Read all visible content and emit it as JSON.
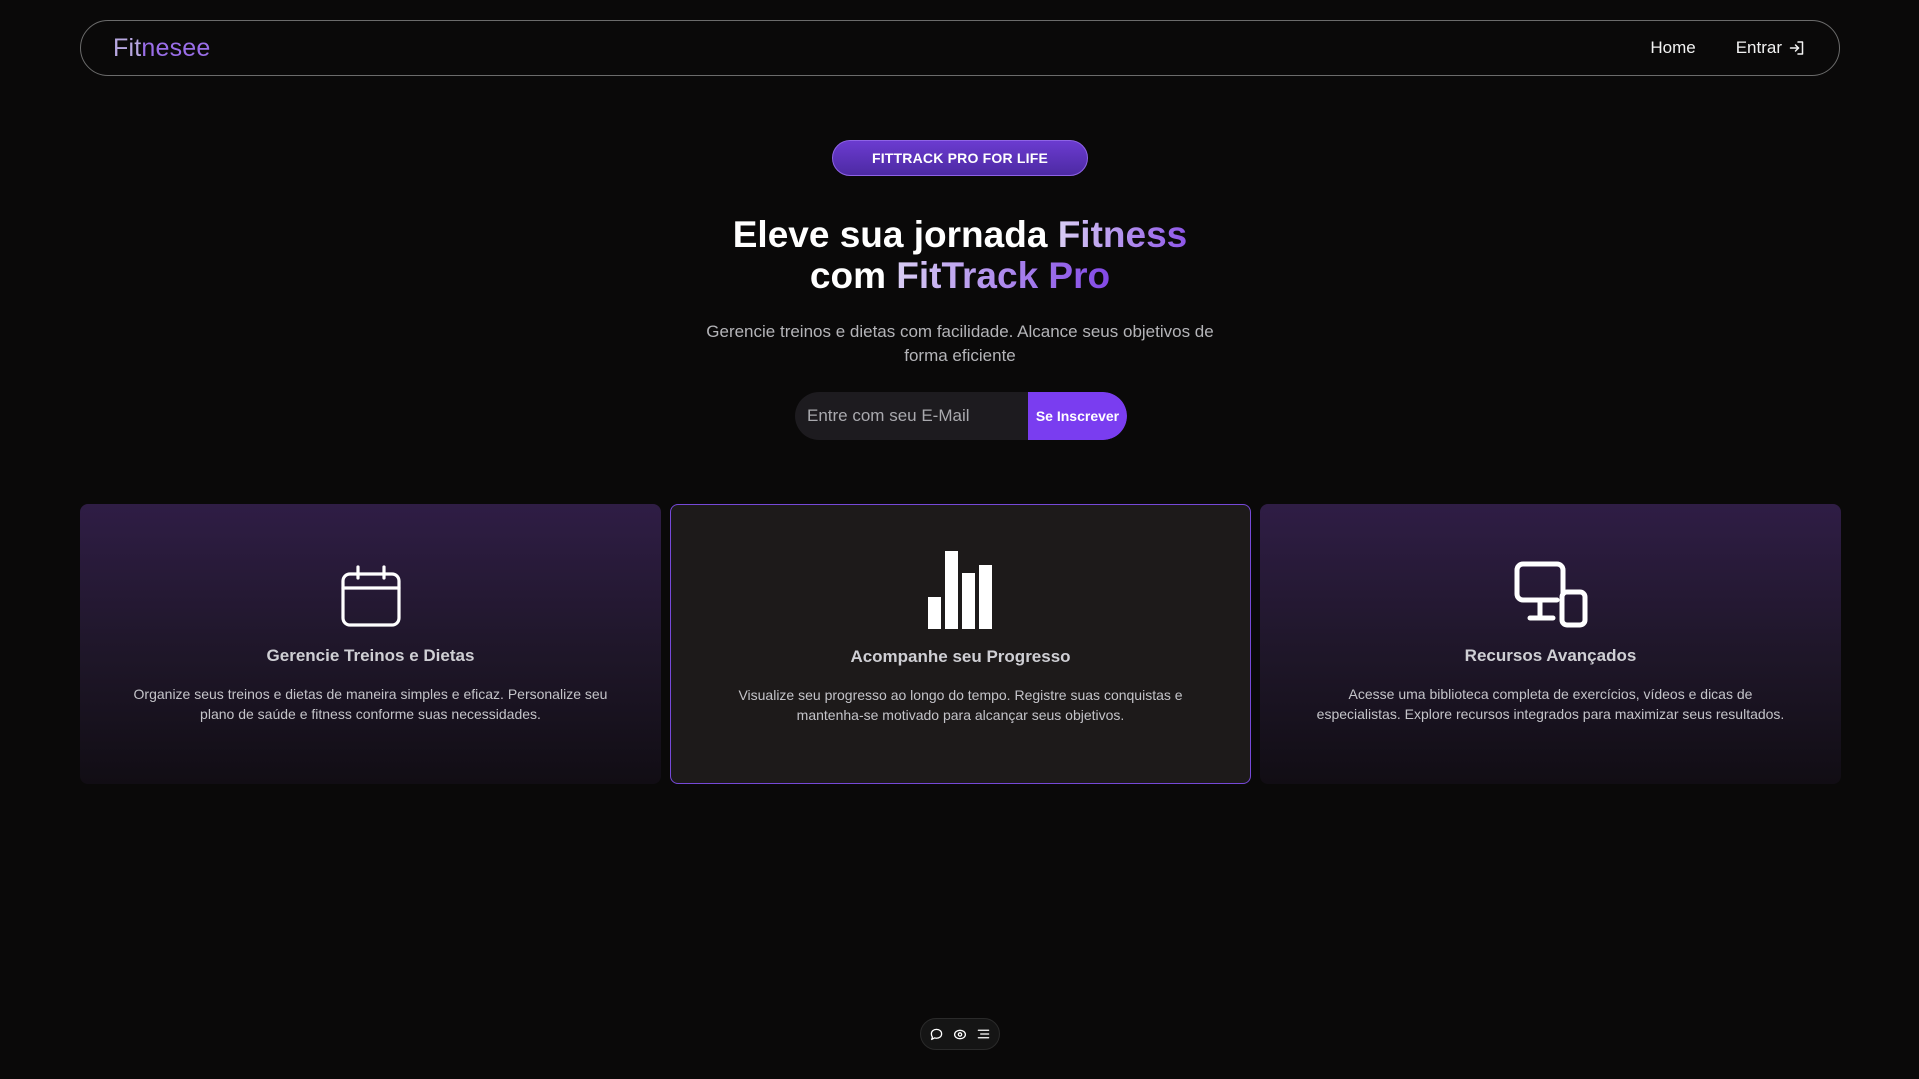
{
  "nav": {
    "logo_part1": "Fit",
    "logo_part2": "nesee",
    "home": "Home",
    "login": "Entrar"
  },
  "hero": {
    "badge": "FITTRACK PRO FOR LIFE",
    "title_line1_a": "Eleve sua jornada ",
    "title_line1_b": "Fitness",
    "title_line2_a": "com ",
    "title_line2_b": "FitTrack Pro",
    "subtitle": "Gerencie treinos e dietas com facilidade. Alcance seus objetivos de forma eficiente"
  },
  "subscribe": {
    "placeholder": "Entre com seu E-Mail",
    "button": "Se Inscrever"
  },
  "cards": [
    {
      "icon": "calendar-icon",
      "title": "Gerencie Treinos e Dietas",
      "description": "Organize seus treinos e dietas de maneira simples e eficaz. Personalize seu plano de saúde e fitness conforme suas necessidades."
    },
    {
      "icon": "bar-chart-icon",
      "title": "Acompanhe seu Progresso",
      "description": "Visualize seu progresso ao longo do tempo. Registre suas conquistas e mantenha-se motivado para alcançar seus objetivos."
    },
    {
      "icon": "devices-icon",
      "title": "Recursos Avançados",
      "description": "Acesse uma biblioteca completa de exercícios, vídeos e dicas de especialistas. Explore recursos integrados para maximizar seus resultados."
    }
  ],
  "colors": {
    "accent": "#7a3df0",
    "background": "#0a0909",
    "card_border": "#7649d8"
  },
  "toolbar_icons": [
    "chat-icon",
    "eye-icon",
    "menu-icon"
  ]
}
